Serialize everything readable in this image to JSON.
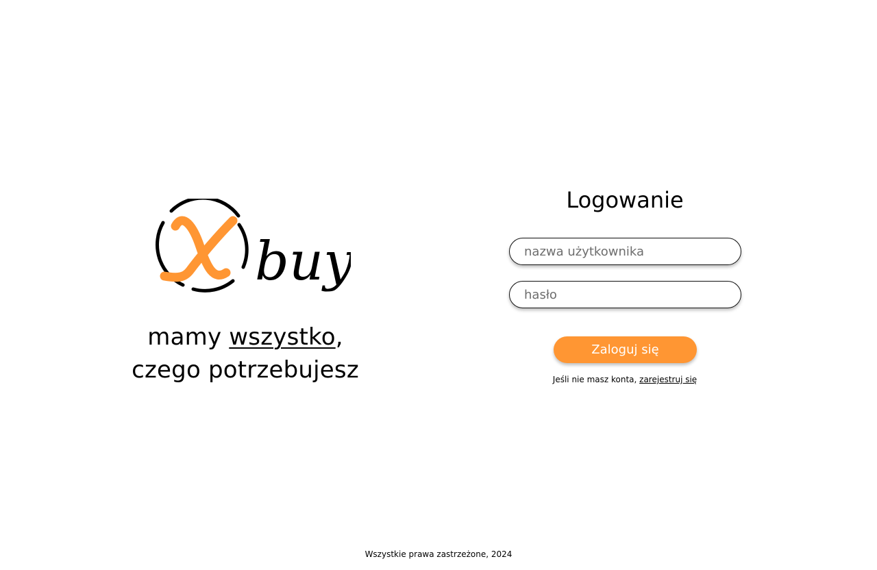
{
  "brand": {
    "logo_letter": "X",
    "logo_text": "buy",
    "accent_color": "#ff9633"
  },
  "tagline": {
    "line1_prefix": "mamy ",
    "line1_underlined": "wszystko",
    "line1_suffix": ",",
    "line2": "czego potrzebujesz"
  },
  "login": {
    "title": "Logowanie",
    "username_placeholder": "nazwa użytkownika",
    "username_value": "",
    "password_placeholder": "hasło",
    "password_value": "",
    "submit_label": "Zaloguj się",
    "register_prompt": "Jeśli nie masz konta, ",
    "register_link": "zarejestruj się"
  },
  "footer": {
    "text": "Wszystkie prawa zastrzeżone, 2024"
  }
}
